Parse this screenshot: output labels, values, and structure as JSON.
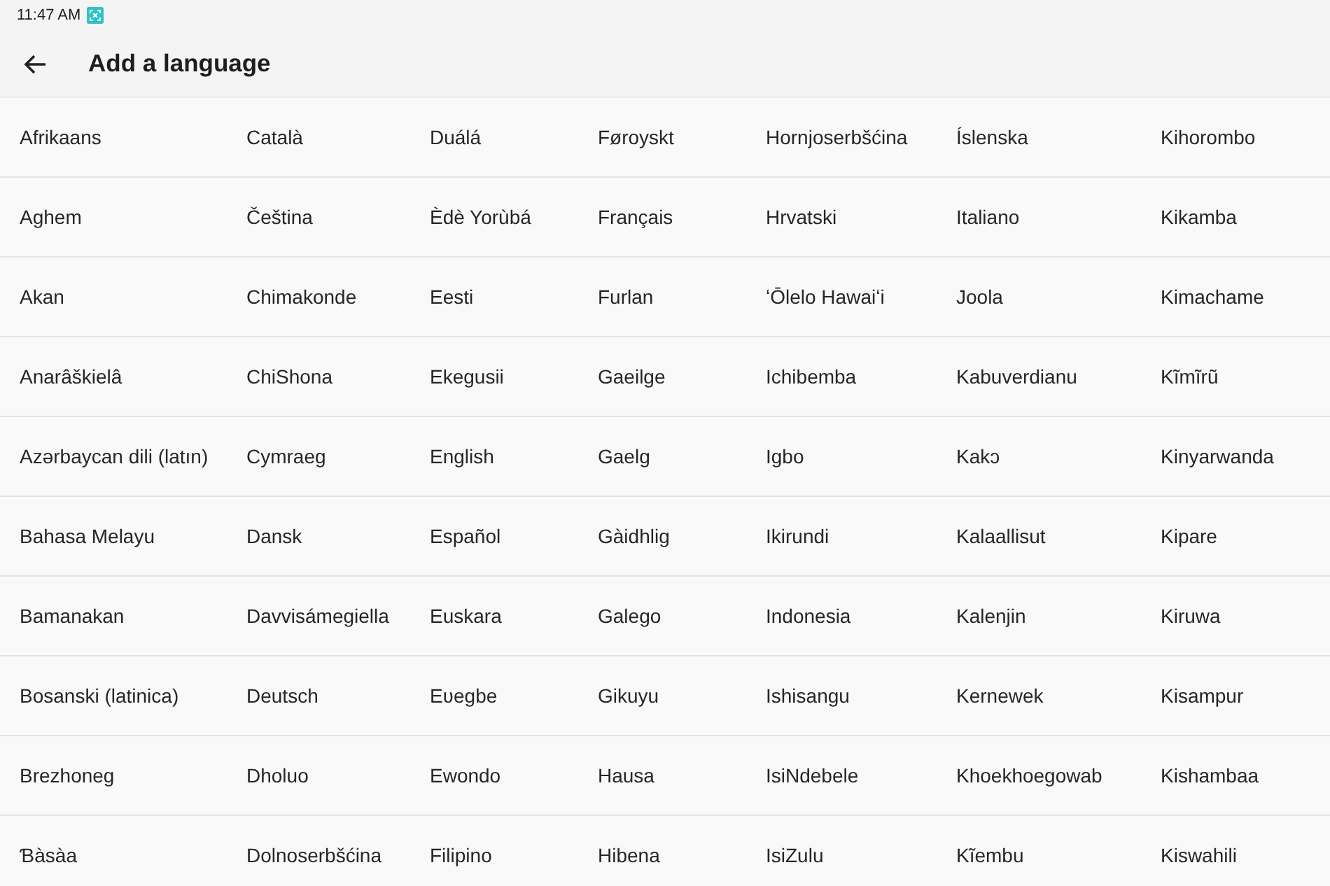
{
  "status_bar": {
    "time": "11:47 AM"
  },
  "app_bar": {
    "title": "Add a language"
  },
  "language_columns": [
    [
      "Afrikaans",
      "Aghem",
      "Akan",
      "Anarâškielâ",
      "Azərbaycan dili (latın)",
      "Bahasa Melayu",
      "Bamanakan",
      "Bosanski (latinica)",
      "Brezhoneg",
      "Ɓàsàa"
    ],
    [
      "Català",
      "Čeština",
      "Chimakonde",
      "ChiShona",
      "Cymraeg",
      "Dansk",
      "Davvisámegiella",
      "Deutsch",
      "Dholuo",
      "Dolnoserbšćina"
    ],
    [
      "Duálá",
      "Èdè Yorùbá",
      "Eesti",
      "Ekegusii",
      "English",
      "Español",
      "Euskara",
      "Eʋegbe",
      "Ewondo",
      "Filipino"
    ],
    [
      "Føroyskt",
      "Français",
      "Furlan",
      "Gaeilge",
      "Gaelg",
      "Gàidhlig",
      "Galego",
      "Gikuyu",
      "Hausa",
      "Hibena"
    ],
    [
      "Hornjoserbšćina",
      "Hrvatski",
      "ʻŌlelo Hawaiʻi",
      "Ichibemba",
      "Igbo",
      "Ikirundi",
      "Indonesia",
      "Ishisangu",
      "IsiNdebele",
      "IsiZulu"
    ],
    [
      "Íslenska",
      "Italiano",
      "Joola",
      "Kabuverdianu",
      "Kakɔ",
      "Kalaallisut",
      "Kalenjin",
      "Kernewek",
      "Khoekhoegowab",
      "Kĩembu"
    ],
    [
      "Kihorombo",
      "Kikamba",
      "Kimachame",
      "Kĩmĩrũ",
      "Kinyarwanda",
      "Kipare",
      "Kiruwa",
      "Kisampur",
      "Kishambaa",
      "Kiswahili"
    ]
  ]
}
